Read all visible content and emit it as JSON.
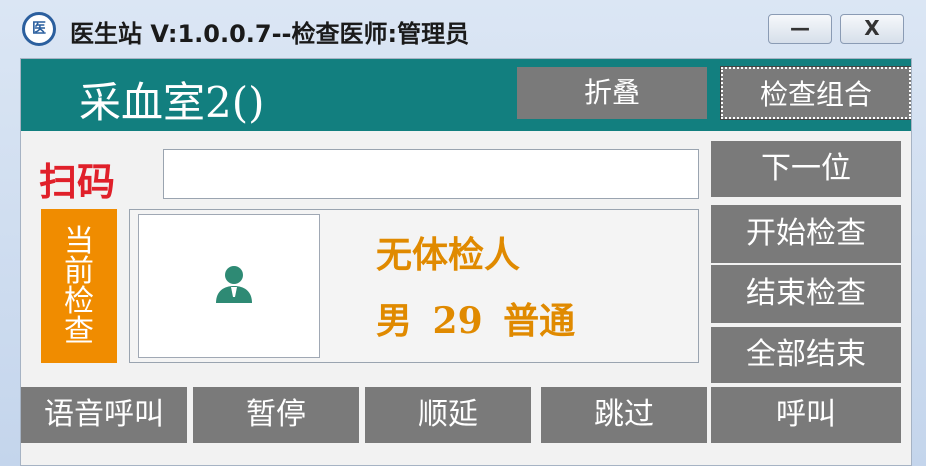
{
  "window": {
    "title": "医生站 V:1.0.0.7--检查医师:管理员",
    "app_icon_text": "医",
    "minimize_label": "—",
    "close_label": "X"
  },
  "header": {
    "room_title": "采血室2()",
    "fold_label": "折叠",
    "combo_label": "检查组合"
  },
  "scan": {
    "label": "扫码",
    "value": "",
    "placeholder": ""
  },
  "side_buttons": {
    "next": "下一位",
    "start_exam": "开始检查",
    "end_exam": "结束检查",
    "end_all": "全部结束"
  },
  "current": {
    "tag_label": "当前检查",
    "patient_name": "无体检人",
    "patient_info": "男 29 普通"
  },
  "bottom_buttons": {
    "voice_call": "语音呼叫",
    "pause": "暂停",
    "postpone": "顺延",
    "skip": "跳过",
    "call": "呼叫"
  },
  "colors": {
    "header_bg": "#127f7f",
    "button_bg": "#7a7a7a",
    "scan_label": "#e0202a",
    "current_tag": "#f08c00",
    "patient_text": "#e08a00"
  },
  "icons": {
    "app": "app-logo-icon",
    "avatar": "user-avatar-icon"
  }
}
